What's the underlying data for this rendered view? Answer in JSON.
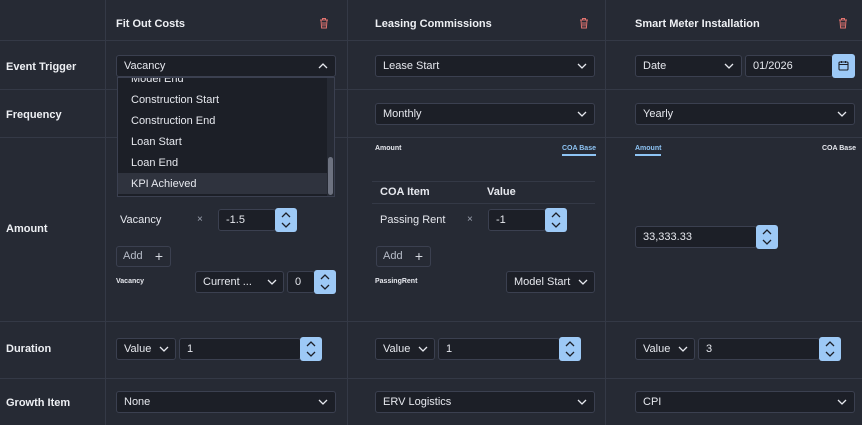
{
  "rows": {
    "event_trigger": "Event Trigger",
    "frequency": "Frequency",
    "amount": "Amount",
    "duration": "Duration",
    "growth_item": "Growth Item"
  },
  "columns": [
    {
      "title": "Fit Out Costs",
      "event_trigger": "Vacancy",
      "dropdown_options": [
        "Model End",
        "Construction Start",
        "Construction End",
        "Loan Start",
        "Loan End",
        "KPI Achieved"
      ],
      "dropdown_selected": "KPI Achieved",
      "amount_item": "Vacancy",
      "amount_value": "-1.5",
      "add_label": "Add",
      "sub_label": "Vacancy",
      "sub_select": "Current ...",
      "sub_value": "0",
      "duration_type": "Value",
      "duration_value": "1",
      "growth": "None"
    },
    {
      "title": "Leasing Commissions",
      "event_trigger": "Lease Start",
      "frequency": "Monthly",
      "tab_amount": "Amount",
      "tab_coa": "COA Base",
      "table_header_item": "COA Item",
      "table_header_value": "Value",
      "amount_item": "Passing Rent",
      "amount_value": "-1",
      "add_label": "Add",
      "sub_label": "PassingRent",
      "sub_select": "Model Start",
      "duration_type": "Value",
      "duration_value": "1",
      "growth": "ERV Logistics"
    },
    {
      "title": "Smart Meter Installation",
      "event_trigger": "Date",
      "date_value": "01/2026",
      "frequency": "Yearly",
      "tab_amount": "Amount",
      "tab_coa": "COA Base",
      "amount_value": "33,333.33",
      "duration_type": "Value",
      "duration_value": "3",
      "growth": "CPI"
    }
  ],
  "colors": {
    "background": "#262a34",
    "field": "#1c1f27",
    "accent": "#9dc9f6",
    "trash": "#e0736f"
  }
}
